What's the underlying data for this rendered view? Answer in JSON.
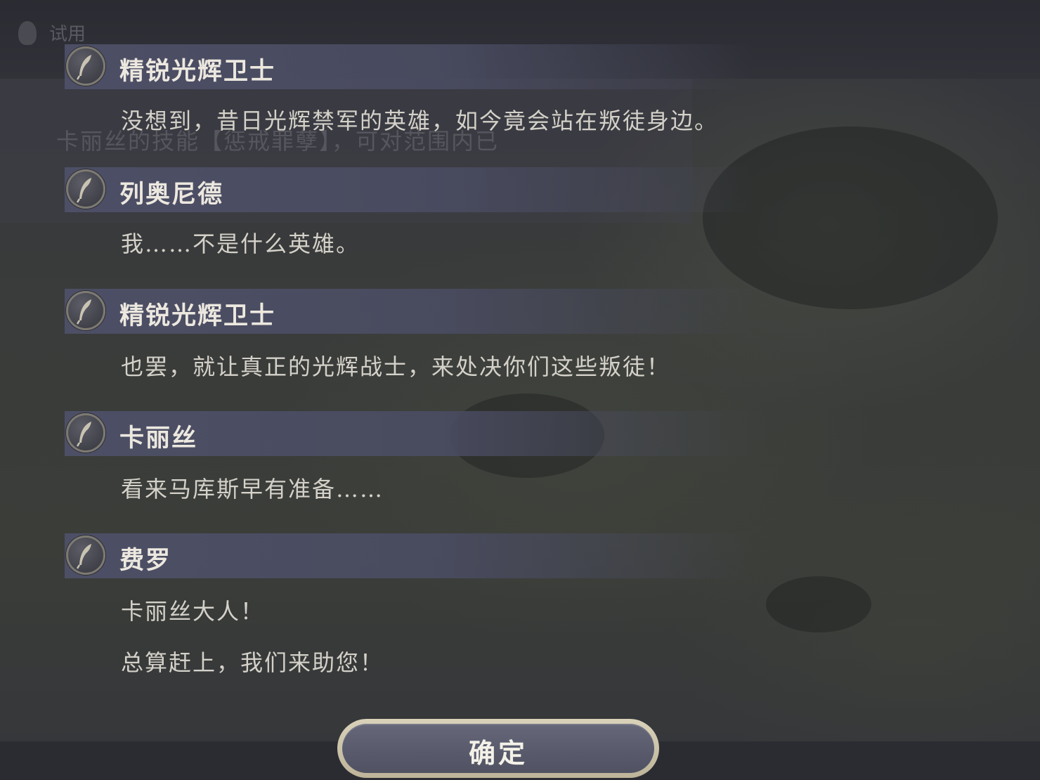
{
  "background": {
    "faded_trial_label": "试用",
    "faded_hint_text": "卡丽丝的技能【惩戒罪孽】，可对范围内已"
  },
  "dialogue_log": [
    {
      "speaker": "精锐光辉卫士",
      "lines": [
        "没想到，昔日光辉禁军的英雄，如今竟会站在叛徒身边。"
      ]
    },
    {
      "speaker": "列奥尼德",
      "lines": [
        "我……不是什么英雄。"
      ]
    },
    {
      "speaker": "精锐光辉卫士",
      "lines": [
        "也罢，就让真正的光辉战士，来处决你们这些叛徒！"
      ]
    },
    {
      "speaker": "卡丽丝",
      "lines": [
        "看来马库斯早有准备……"
      ]
    },
    {
      "speaker": "费罗",
      "lines": [
        "卡丽丝大人！",
        "总算赶上，我们来助您！"
      ]
    }
  ],
  "confirm_button": {
    "label": "确定"
  },
  "colors": {
    "name_bar": "#4e5068",
    "name_text": "#ece8df",
    "line_text": "#d4d1c9",
    "button_border": "#d9d2b9",
    "button_fill": "#5c5e70"
  },
  "icons": {
    "speaker_icon": "quill-feather-icon"
  }
}
